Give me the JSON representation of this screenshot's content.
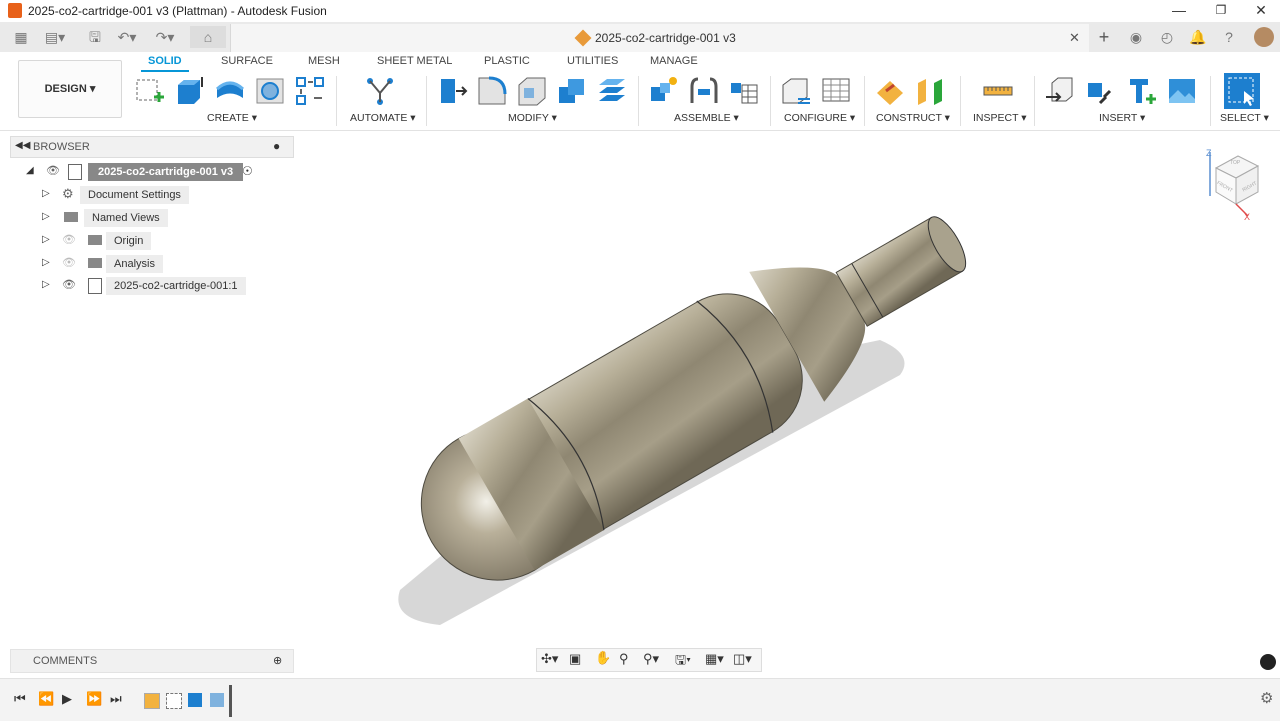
{
  "window": {
    "title": "2025-co2-cartridge-001 v3 (Plattman) - Autodesk Fusion"
  },
  "document_tab": {
    "name": "2025-co2-cartridge-001 v3"
  },
  "workspace": {
    "label": "DESIGN"
  },
  "tabs": [
    {
      "label": "SOLID",
      "active": true
    },
    {
      "label": "SURFACE"
    },
    {
      "label": "MESH"
    },
    {
      "label": "SHEET METAL"
    },
    {
      "label": "PLASTIC"
    },
    {
      "label": "UTILITIES"
    },
    {
      "label": "MANAGE"
    }
  ],
  "groups": [
    "CREATE",
    "AUTOMATE",
    "MODIFY",
    "ASSEMBLE",
    "CONFIGURE",
    "CONSTRUCT",
    "INSPECT",
    "INSERT",
    "SELECT"
  ],
  "browser": {
    "title": "BROWSER",
    "root": "2025-co2-cartridge-001 v3",
    "items": [
      "Document Settings",
      "Named Views",
      "Origin",
      "Analysis",
      "2025-co2-cartridge-001:1"
    ]
  },
  "comments": {
    "title": "COMMENTS"
  },
  "viewcube": {
    "axis_z": "Z",
    "axis_x": "X",
    "front": "FRONT",
    "right": "RIGHT",
    "top": "TOP"
  },
  "colors": {
    "accent": "#0696d7",
    "body_metal": "#9c9480"
  }
}
